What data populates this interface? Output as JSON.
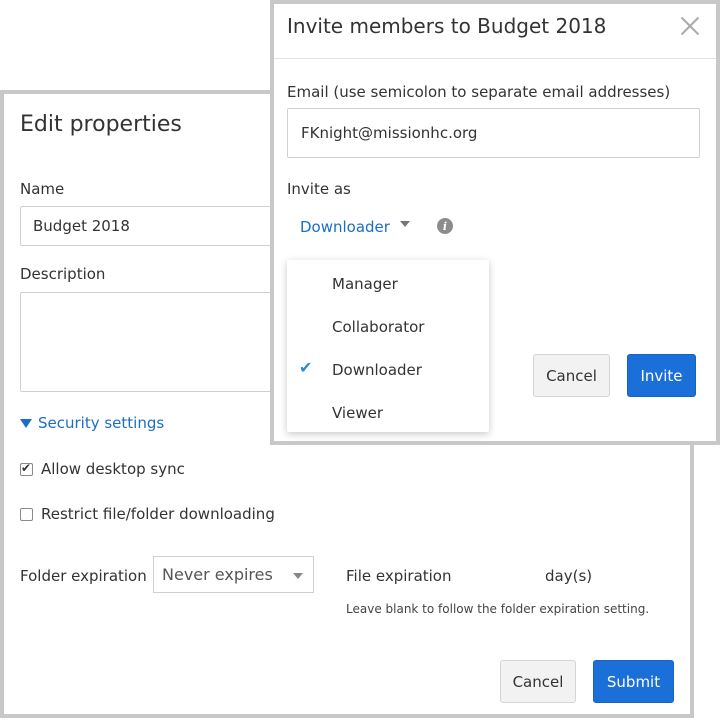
{
  "edit_dialog": {
    "title": "Edit properties",
    "name_label": "Name",
    "name_value": "Budget 2018",
    "description_label": "Description",
    "description_value": "",
    "security_toggle_label": "Security settings",
    "allow_sync_label": "Allow desktop sync",
    "allow_sync_checked": true,
    "restrict_download_label": "Restrict file/folder downloading",
    "restrict_download_checked": false,
    "folder_expiration_label": "Folder expiration",
    "folder_expiration_value": "Never expires",
    "file_expiration_label": "File expiration",
    "file_expiration_unit": "day(s)",
    "file_expiration_hint": "Leave blank to follow the folder expiration setting.",
    "cancel_label": "Cancel",
    "submit_label": "Submit"
  },
  "invite_dialog": {
    "title": "Invite members to Budget 2018",
    "email_label": "Email (use semicolon to separate email addresses)",
    "email_value": "FKnight@missionhc.org",
    "invite_as_label": "Invite as",
    "selected_role": "Downloader",
    "info_icon_glyph": "i",
    "roles": [
      {
        "label": "Manager",
        "selected": false
      },
      {
        "label": "Collaborator",
        "selected": false
      },
      {
        "label": "Downloader",
        "selected": true
      },
      {
        "label": "Viewer",
        "selected": false
      }
    ],
    "cancel_label": "Cancel",
    "invite_label": "Invite"
  },
  "colors": {
    "link_blue": "#1a6fc4",
    "primary_button": "#1a6fd8",
    "checkmark": "#2b8ad8",
    "dialog_border": "#c8c8c8"
  }
}
